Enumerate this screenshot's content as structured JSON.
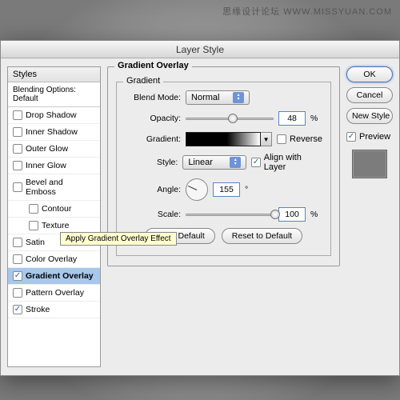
{
  "watermark": "思缘设计论坛  WWW.MISSYUAN.COM",
  "dialog": {
    "title": "Layer Style"
  },
  "styles": {
    "header": "Styles",
    "blending_options": "Blending Options: Default",
    "items": [
      {
        "label": "Drop Shadow",
        "checked": false
      },
      {
        "label": "Inner Shadow",
        "checked": false
      },
      {
        "label": "Outer Glow",
        "checked": false
      },
      {
        "label": "Inner Glow",
        "checked": false
      },
      {
        "label": "Bevel and Emboss",
        "checked": false
      },
      {
        "label": "Contour",
        "checked": false,
        "indent": true
      },
      {
        "label": "Texture",
        "checked": false,
        "indent": true
      },
      {
        "label": "Satin",
        "checked": false
      },
      {
        "label": "Color Overlay",
        "checked": false
      },
      {
        "label": "Gradient Overlay",
        "checked": true,
        "selected": true
      },
      {
        "label": "Pattern Overlay",
        "checked": false
      },
      {
        "label": "Stroke",
        "checked": true
      }
    ]
  },
  "tooltip": "Apply Gradient Overlay Effect",
  "gradient_overlay": {
    "group_title": "Gradient Overlay",
    "sub_title": "Gradient",
    "blend_mode_label": "Blend Mode:",
    "blend_mode_value": "Normal",
    "opacity_label": "Opacity:",
    "opacity_value": "48",
    "gradient_label": "Gradient:",
    "reverse_label": "Reverse",
    "style_label": "Style:",
    "style_value": "Linear",
    "align_label": "Align with Layer",
    "angle_label": "Angle:",
    "angle_value": "155",
    "angle_unit": "°",
    "scale_label": "Scale:",
    "scale_value": "100",
    "percent": "%",
    "make_default": "Make Default",
    "reset_default": "Reset to Default"
  },
  "right": {
    "ok": "OK",
    "cancel": "Cancel",
    "new_style": "New Style",
    "preview": "Preview"
  }
}
